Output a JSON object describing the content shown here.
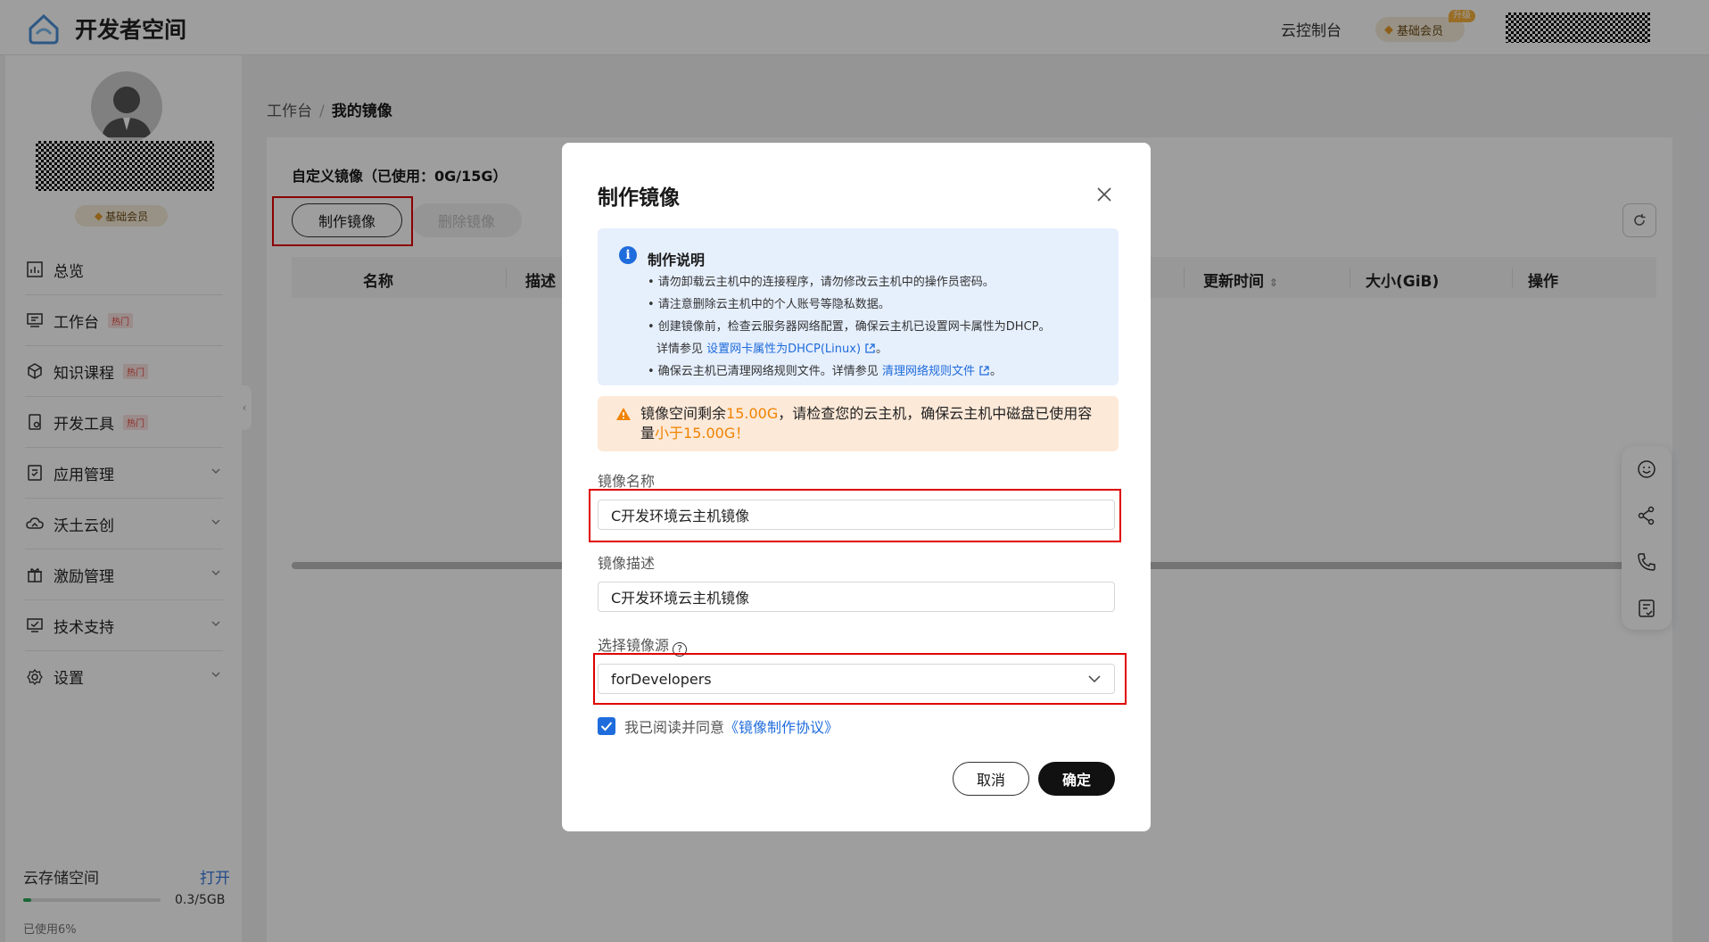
{
  "header": {
    "brand": "开发者空间",
    "console": "云控制台",
    "member_label": "基础会员",
    "upgrade_tag": "升级"
  },
  "sidebar": {
    "member_badge": "基础会员",
    "items": [
      {
        "label": "总览",
        "icon": "overview-icon"
      },
      {
        "label": "工作台",
        "icon": "workbench-icon",
        "hot": "热门"
      },
      {
        "label": "知识课程",
        "icon": "course-icon",
        "hot": "热门"
      },
      {
        "label": "开发工具",
        "icon": "devtools-icon",
        "hot": "热门"
      },
      {
        "label": "应用管理",
        "icon": "app-management-icon",
        "expandable": true
      },
      {
        "label": "沃土云创",
        "icon": "cloud-create-icon",
        "expandable": true
      },
      {
        "label": "激励管理",
        "icon": "gift-icon",
        "expandable": true
      },
      {
        "label": "技术支持",
        "icon": "support-icon",
        "expandable": true
      },
      {
        "label": "设置",
        "icon": "settings-icon",
        "expandable": true
      }
    ],
    "storage": {
      "title": "云存储空间",
      "open": "打开",
      "amount": "0.3/5GB",
      "used_text": "已使用6%",
      "used_fraction": 0.06
    }
  },
  "main": {
    "breadcrumb": {
      "root": "工作台",
      "sep": "/",
      "current": "我的镜像"
    },
    "panel_title": "自定义镜像（已使用：0G/15G）",
    "make_button": "制作镜像",
    "delete_button": "删除镜像",
    "table_headers": [
      "名称",
      "描述",
      "更新时间",
      "大小(GiB)",
      "操作"
    ]
  },
  "modal": {
    "title": "制作镜像",
    "info": {
      "title": "制作说明",
      "lines": [
        "• 请勿卸载云主机中的连接程序，请勿修改云主机中的操作员密码。",
        "• 请注意删除云主机中的个人账号等隐私数据。",
        "• 创建镜像前，检查云服务器网络配置，确保云主机已设置网卡属性为DHCP。"
      ],
      "line4_prefix": "详情参见 ",
      "line4_link": "设置网卡属性为DHCP(Linux)",
      "line4_suffix": "。",
      "line5_prefix": "• 确保云主机已清理网络规则文件。详情参见 ",
      "line5_link": "清理网络规则文件",
      "line5_suffix": "。"
    },
    "warning": {
      "part1": "镜像空间剩余",
      "space": "15.00G",
      "part2": "，请检查您的云主机，确保云主机中磁盘已使用容量",
      "limit": "小于15.00G！"
    },
    "name_label": "镜像名称",
    "name_value": "C开发环境云主机镜像",
    "desc_label": "镜像描述",
    "desc_value": "C开发环境云主机镜像",
    "source_label": "选择镜像源",
    "source_value": "forDevelopers",
    "agree_text": "我已阅读并同意",
    "agree_link": "《镜像制作协议》",
    "agree_checked": true,
    "cancel": "取消",
    "confirm": "确定"
  },
  "colors": {
    "accent": "#1f6cdc",
    "warning": "#f08300",
    "highlight_box": "#e00000"
  }
}
